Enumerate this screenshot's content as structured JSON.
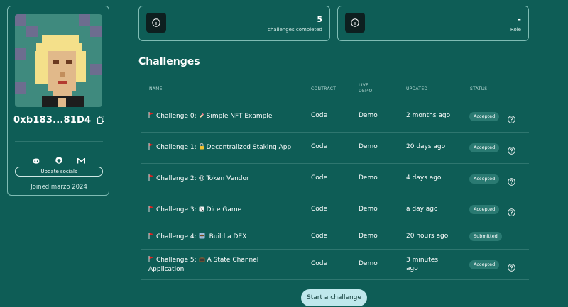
{
  "profile": {
    "address": "0xb183...81D4",
    "update_socials_label": "Update socials",
    "joined": "Joined marzo 2024",
    "socials": [
      "discord-icon",
      "github-icon",
      "gmail-icon"
    ]
  },
  "stats": [
    {
      "value": "5",
      "label": "challenges completed",
      "icon": "info-icon"
    },
    {
      "value": "-",
      "label": "Role",
      "icon": "info-icon"
    }
  ],
  "challenges_title": "Challenges",
  "table_headers": {
    "name": "NAME",
    "contract": "CONTRACT",
    "live_demo_1": "LIVE",
    "live_demo_2": "DEMO",
    "updated": "UPDATED",
    "status": "STATUS"
  },
  "challenges": [
    {
      "prefix": "Challenge 0:",
      "emoji": "pencil",
      "title": "Simple NFT Example",
      "contract": "Code",
      "demo": "Demo",
      "updated": "2 months ago",
      "status": "Accepted"
    },
    {
      "prefix": "Challenge 1:",
      "emoji": "lock",
      "title": "Decentralized Staking App",
      "contract": "Code",
      "demo": "Demo",
      "updated": "20 days ago",
      "status": "Accepted"
    },
    {
      "prefix": "Challenge 2:",
      "emoji": "coin",
      "title": "Token Vendor",
      "contract": "Code",
      "demo": "Demo",
      "updated": "4 days ago",
      "status": "Accepted"
    },
    {
      "prefix": "Challenge 3:",
      "emoji": "dice",
      "title": "Dice Game",
      "contract": "Code",
      "demo": "Demo",
      "updated": "a day ago",
      "status": "Accepted"
    },
    {
      "prefix": "Challenge 4:",
      "emoji": "dex",
      "title": "Build a DEX",
      "contract": "Code",
      "demo": "Demo",
      "updated": "20 hours ago",
      "status": "Submitted"
    },
    {
      "prefix": "Challenge 5:",
      "emoji": "tv",
      "title": "A State Channel",
      "title_line2": "Application",
      "contract": "Code",
      "demo": "Demo",
      "updated": "3 minutes",
      "updated_line2": "ago",
      "status": "Accepted"
    }
  ],
  "start_button": "Start a challenge"
}
